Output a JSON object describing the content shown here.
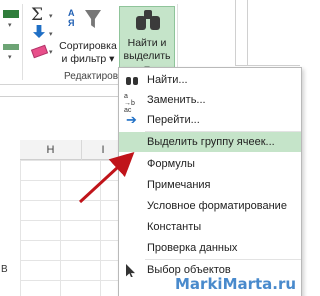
{
  "ribbon": {
    "sort_filter": {
      "line1": "Сортировка",
      "line2": "и фильтр"
    },
    "find_select": {
      "line1": "Найти и",
      "line2": "выделить"
    },
    "group_label": "Редактирова"
  },
  "sheet": {
    "columns": [
      "H",
      "I"
    ],
    "cell_fragment": "В"
  },
  "menu": {
    "items": [
      {
        "label": "Найти...",
        "icon": "binoculars-icon"
      },
      {
        "label": "Заменить...",
        "icon": "replace-icon"
      },
      {
        "label": "Перейти...",
        "icon": "arrow-right-icon"
      },
      {
        "label": "Выделить группу ячеек...",
        "highlighted": true
      },
      {
        "label": "Формулы"
      },
      {
        "label": "Примечания"
      },
      {
        "label": "Условное форматирование"
      },
      {
        "label": "Константы"
      },
      {
        "label": "Проверка данных"
      },
      {
        "label": "Выбор объектов",
        "icon": "cursor-icon"
      }
    ]
  },
  "watermark": "MarkiMarta.ru",
  "colors": {
    "accent_highlight": "#c5e4c9",
    "annotation_arrow": "#c0141a",
    "watermark": "#2a76c4"
  }
}
